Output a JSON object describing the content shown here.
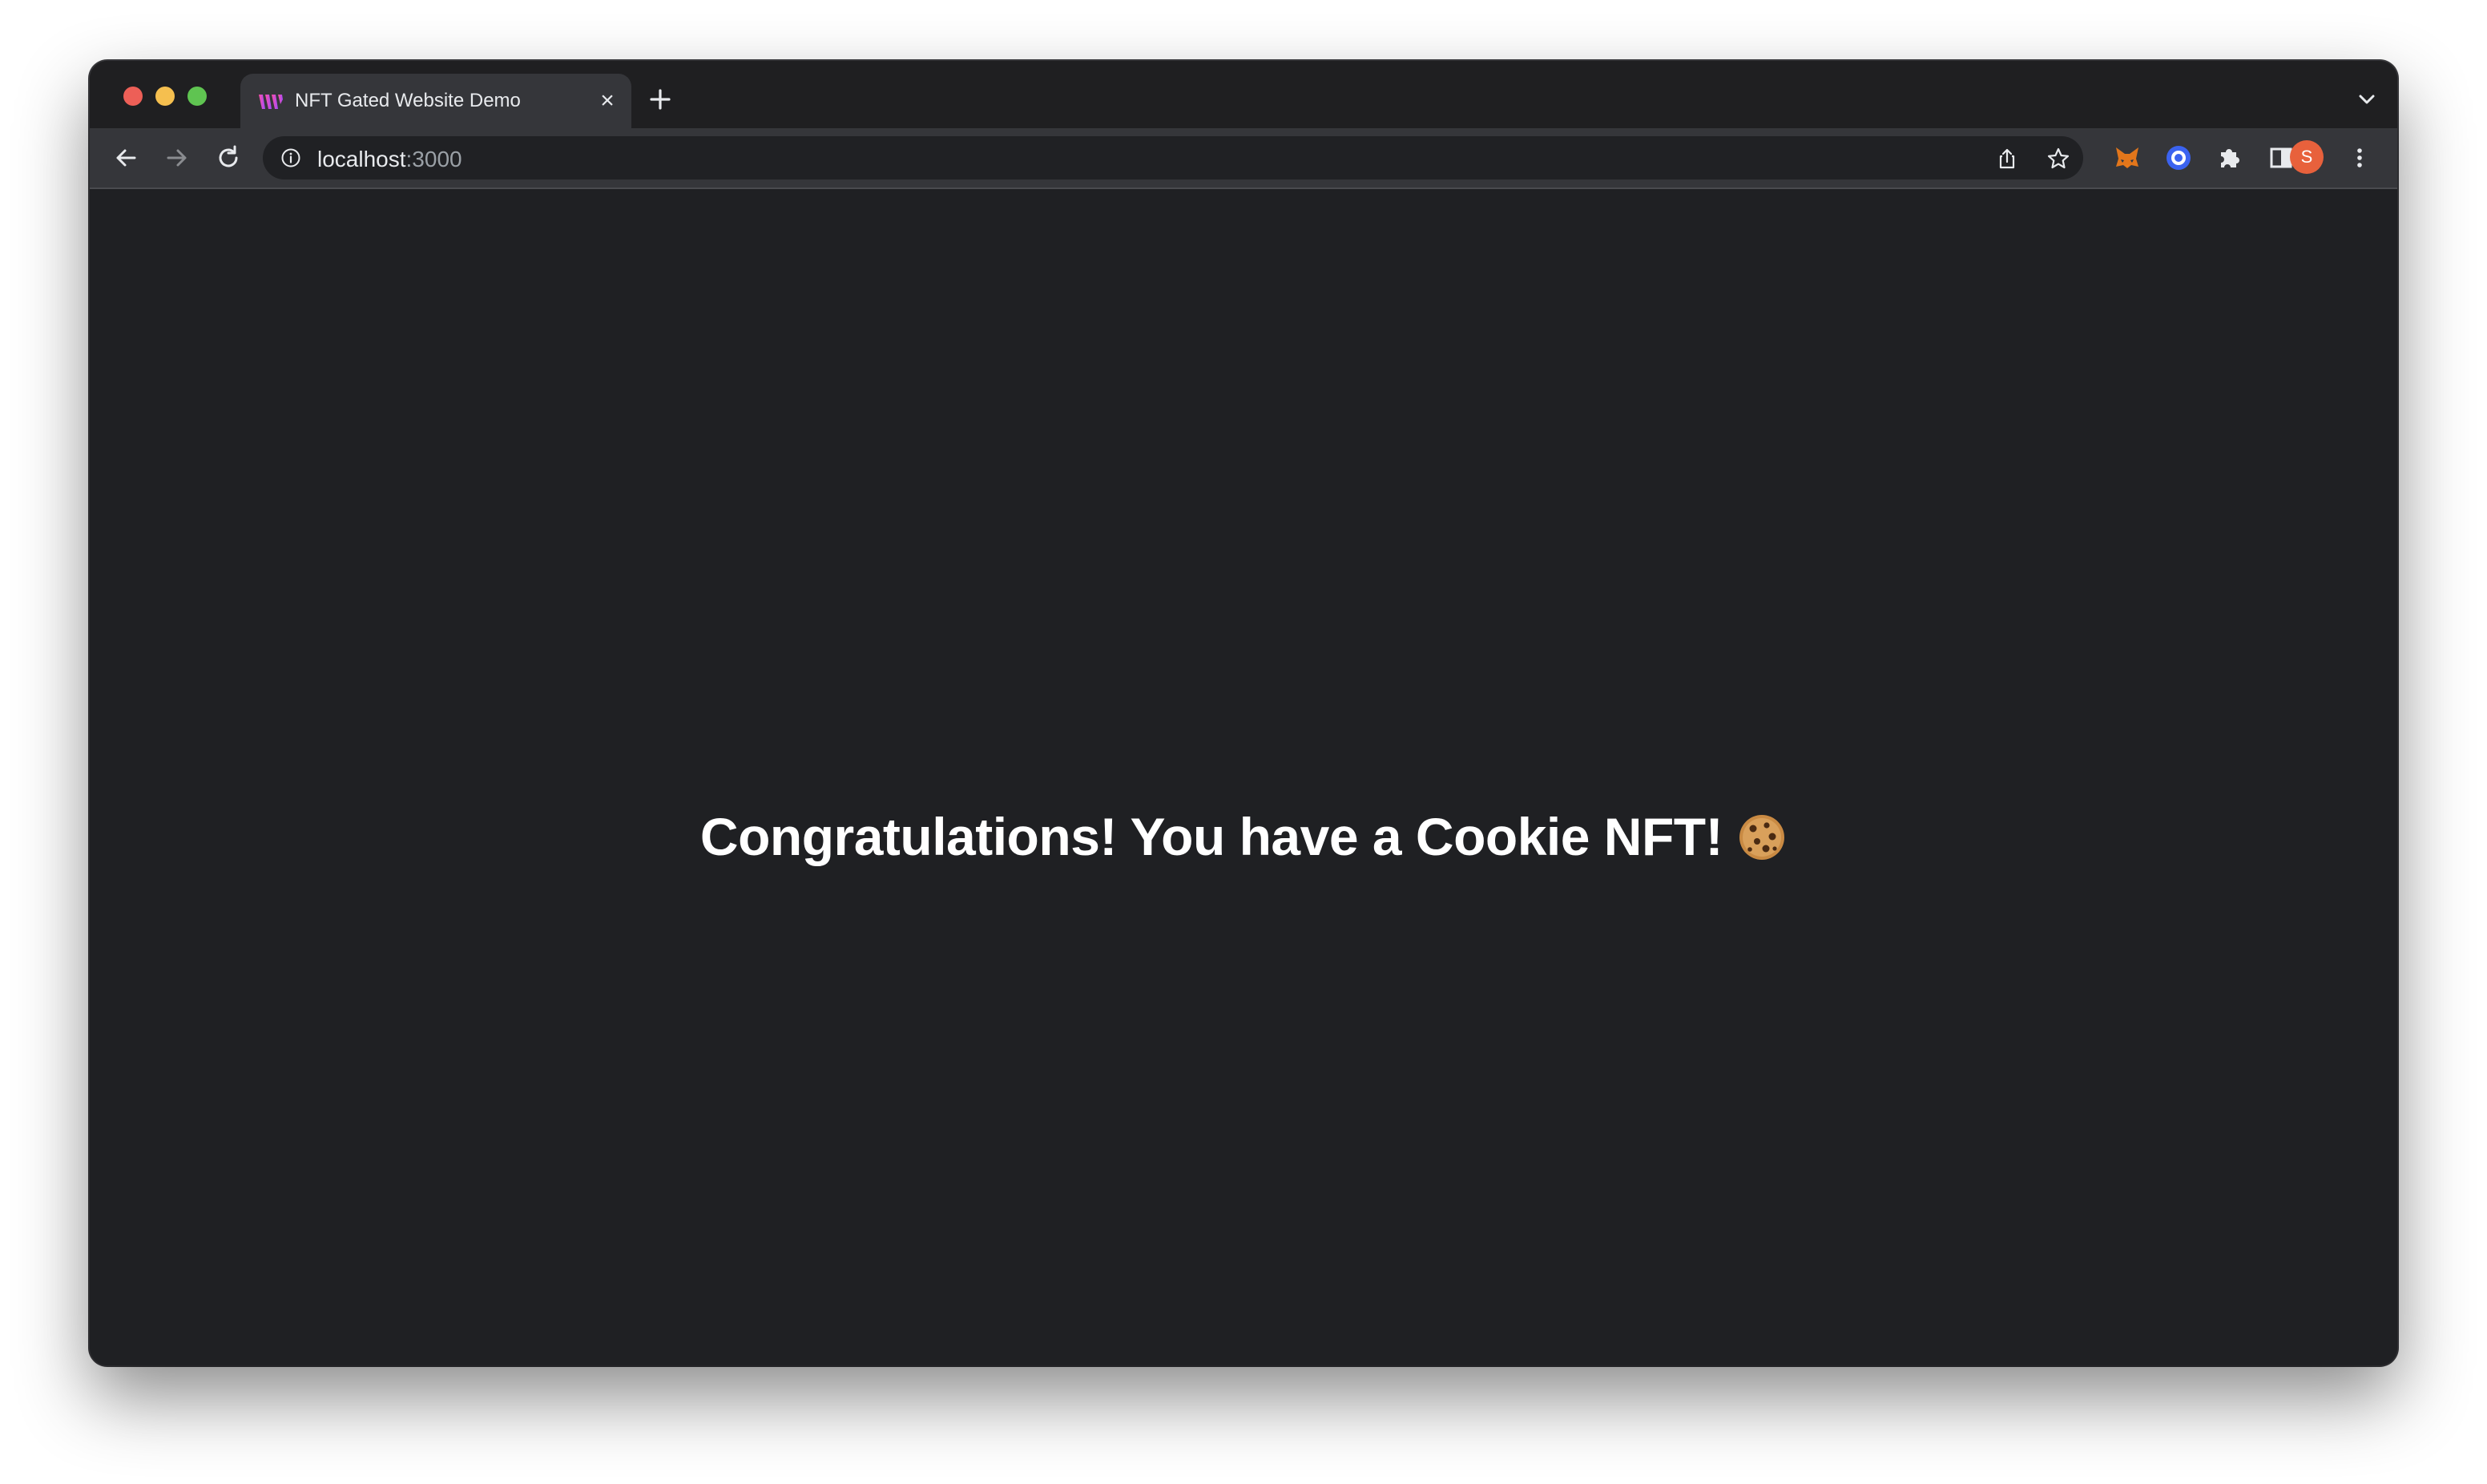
{
  "browser": {
    "tab": {
      "title": "NFT Gated Website Demo",
      "close_glyph": "×",
      "favicon": "wave-logo-icon"
    },
    "address_bar": {
      "host": "localhost",
      "port": ":3000"
    },
    "profile_initial": "S",
    "extensions": [
      "metamask-fox-icon",
      "blue-circle-extension-icon",
      "puzzle-extensions-icon",
      "side-panel-icon"
    ]
  },
  "page": {
    "headline": "Congratulations! You have a Cookie NFT!",
    "emoji": "cookie-icon",
    "background_color": "#1f2023",
    "text_color": "#ffffff"
  },
  "colors": {
    "titlebar": "#1f1f21",
    "toolbar": "#35363a",
    "omnibox": "#202124",
    "avatar": "#e8613c",
    "traffic_red": "#ed5f57",
    "traffic_yellow": "#f5bf4f",
    "traffic_green": "#5fc451"
  }
}
